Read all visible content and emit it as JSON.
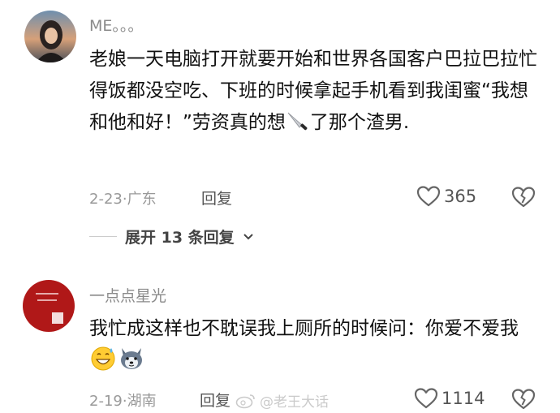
{
  "comments": [
    {
      "username": "ME。。。",
      "text_before_icon": "老娘一天电脑打开就要开始和世界各国客户巴拉巴拉忙得饭都没空吃、下班的时候拿起手机看到我闺蜜“我想和他和好！”劳资真的想",
      "inline_icon": "knife-emoji",
      "text_after_icon": "了那个渣男.",
      "date": "2-23",
      "separator": "·",
      "location": "广东",
      "reply_label": "回复",
      "like_count": "365",
      "like_icon": "heart-outline-icon",
      "dislike_icon": "broken-heart-icon",
      "expand_label": "展开 13 条回复"
    },
    {
      "username": "一点点星光",
      "text": "我忙成这样也不耽误我上厕所的时候问：你爱不爱我",
      "emojis": [
        "grinning-sweat-emoji",
        "husky-dog-emoji"
      ],
      "date": "2-19",
      "separator": "·",
      "location": "湖南",
      "reply_label": "回复",
      "like_count": "1114",
      "like_icon": "heart-outline-icon",
      "dislike_icon": "broken-heart-icon"
    }
  ],
  "watermark": {
    "text": "@老王大话",
    "icon": "weibo-logo-icon"
  },
  "colors": {
    "text_primary": "#111111",
    "text_secondary": "#999999",
    "avatar2_red": "#b01818"
  }
}
